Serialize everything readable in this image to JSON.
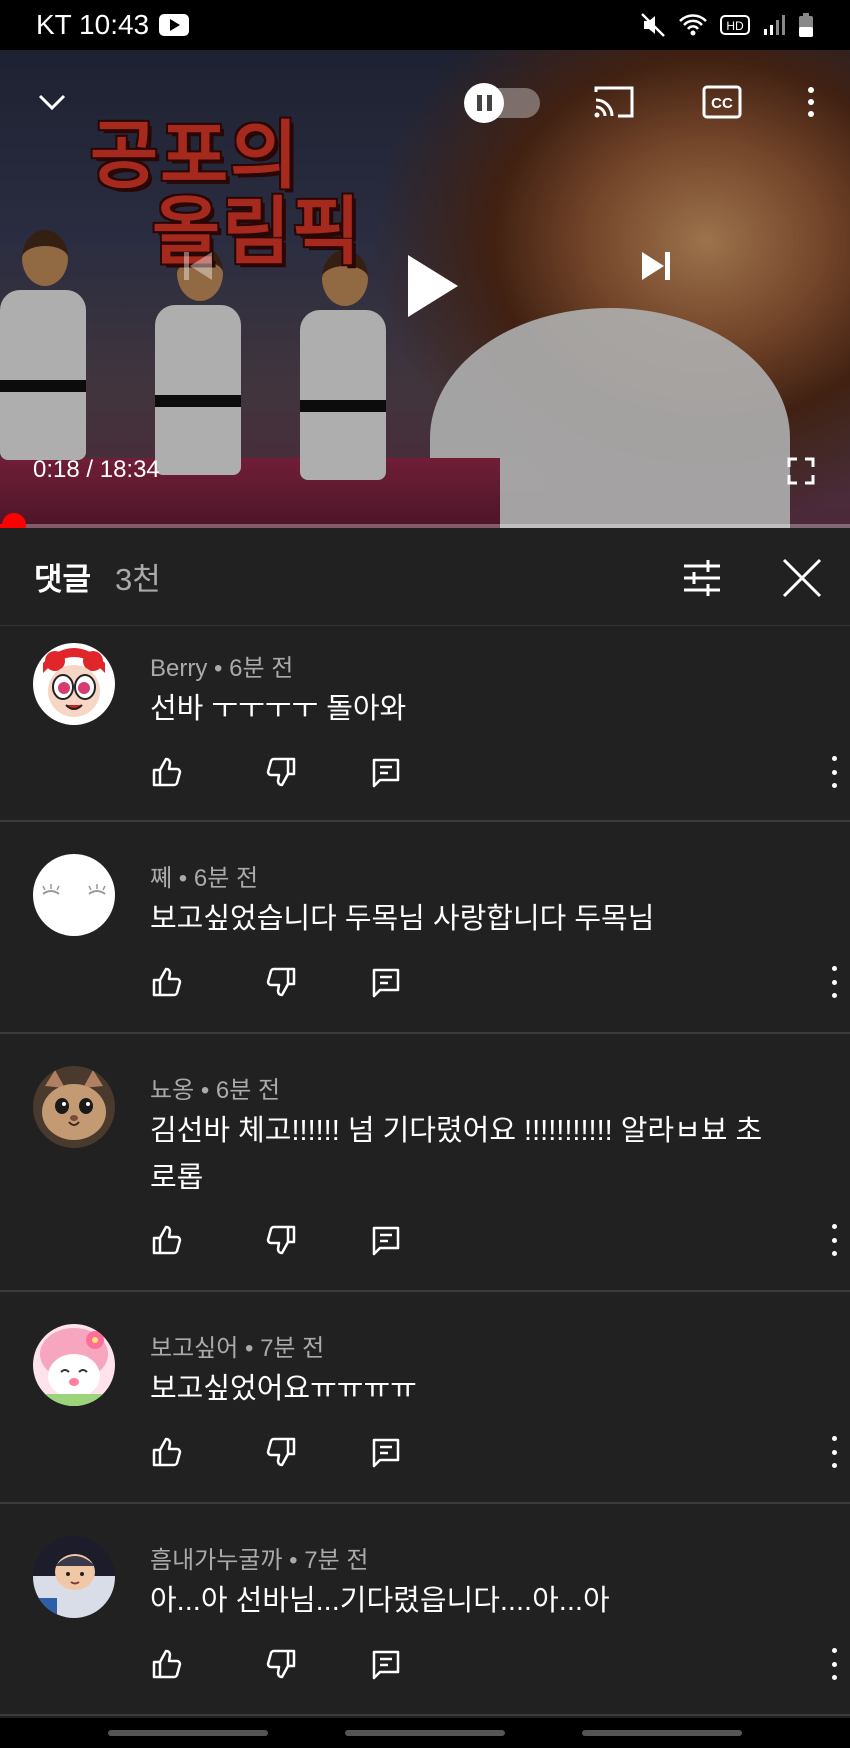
{
  "status_bar": {
    "carrier_time": "KT 10:43",
    "hd_label": "HD"
  },
  "player": {
    "thumbnail_title_line1": "공포의",
    "thumbnail_title_line2": "올림픽",
    "time_display": "0:18 / 18:34",
    "progress_fraction": 0.016,
    "controls": [
      "collapse-chevron-icon",
      "autoplay-toggle",
      "cast-icon",
      "captions-icon",
      "more-vert-icon",
      "previous-icon",
      "play-icon",
      "next-icon",
      "fullscreen-icon"
    ],
    "cc_label": "CC"
  },
  "comments_header": {
    "title": "댓글",
    "count": "3천"
  },
  "comments": [
    {
      "author": "Berry",
      "age": "6분 전",
      "text": "선바 ㅜㅜㅜㅜ 돌아와",
      "avatar": "powerpuff-avatar"
    },
    {
      "author": "쪠",
      "age": "6분 전",
      "text": "보고싶었습니다 두목님 사랑합니다 두목님",
      "avatar": "sleepy-face-avatar"
    },
    {
      "author": "뇨옹",
      "age": "6분 전",
      "text": "김선바 체고!!!!!! 넘 기다렸어요 !!!!!!!!!!! 알라ㅂ뵤 초로롭",
      "avatar": "cat-avatar"
    },
    {
      "author": "보고싶어",
      "age": "7분 전",
      "text": "보고싶었어요ㅠㅠㅠㅠ",
      "avatar": "my-melody-avatar"
    },
    {
      "author": "흠내가누굴까",
      "age": "7분 전",
      "text": "아...아 선바님...기다렸읍니다....아...아",
      "avatar": "character-avatar"
    }
  ],
  "colors": {
    "background": "#212121",
    "divider": "#3a3a3a",
    "meta_text": "#aaaaaa",
    "progress": "#ff0000"
  }
}
